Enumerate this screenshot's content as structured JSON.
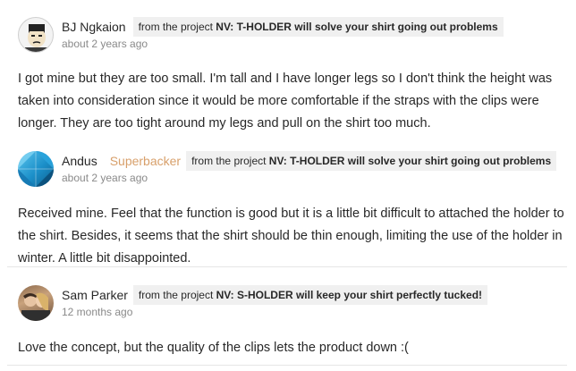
{
  "comments": [
    {
      "author": "BJ Ngkaion",
      "badge": "",
      "project_prefix": "from the project ",
      "project_name": "NV: T-HOLDER will solve your shirt going out problems",
      "time": "about 2 years ago",
      "body": "I got mine but they are too small. I'm tall and I have longer legs so I don't think the height was taken into consideration since it would be more comfortable if the straps with the clips were longer. They are too tight around my legs and pull on the shirt too much."
    },
    {
      "author": "Andus",
      "badge": "Superbacker",
      "project_prefix": "from the project ",
      "project_name": "NV: T-HOLDER will solve your shirt going out problems",
      "time": "about 2 years ago",
      "body": "Received mine. Feel that the function is good but it is a little bit difficult to attached the holder to the shirt. Besides, it seems that the shirt should be thin enough, limiting the use of the holder in winter. A little bit disappointed."
    },
    {
      "author": "Sam Parker",
      "badge": "",
      "project_prefix": "from the project ",
      "project_name": "NV: S-HOLDER will keep your shirt perfectly tucked!",
      "time": "12 months ago",
      "body": "Love the concept, but the quality of the clips lets the product down :("
    }
  ],
  "colors": {
    "badge": "#d8a06b",
    "project_bg": "#f0f0f0",
    "time": "#8a8a8a"
  },
  "avatars": [
    "cartoon-face-avatar",
    "blue-geometric-avatar",
    "couple-photo-avatar"
  ]
}
